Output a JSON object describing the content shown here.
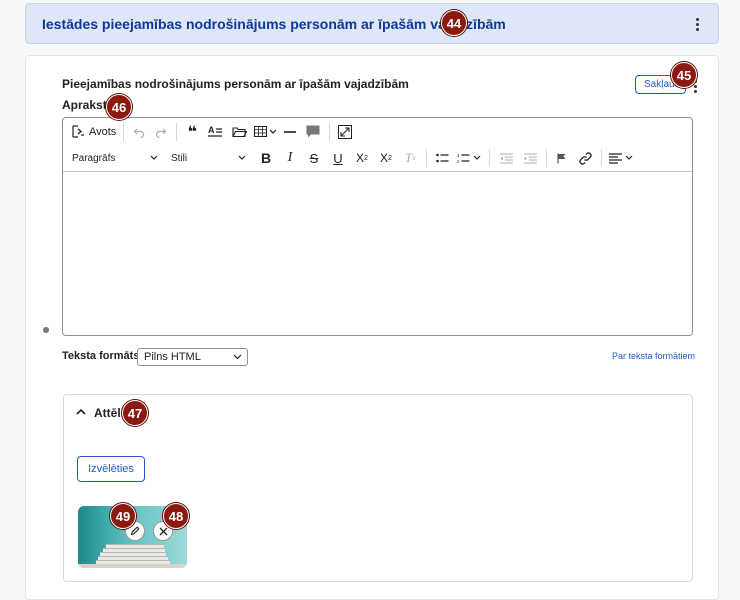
{
  "header": {
    "title": "Iestādes pieejamības nodrošinājums personām ar īpašām vajadzībām"
  },
  "field": {
    "title": "Pieejamības nodrošinājums personām ar īpašām vajadzībām",
    "collapse_label": "Sakļaut"
  },
  "description": {
    "label": "Apraksts",
    "toolbar": {
      "source_label": "Avots",
      "paragraph_label": "Paragrāfs",
      "styles_label": "Stili",
      "bold_label": "B",
      "italic_label": "I",
      "strike_label": "S",
      "underline_label": "U",
      "superscript_label": "X",
      "subscript_label": "X",
      "clear_format_label": "T"
    }
  },
  "text_format": {
    "label": "Teksta formāts",
    "selected": "Pilns HTML",
    "help_link": "Par teksta formātiem"
  },
  "images": {
    "title": "Attēli",
    "choose_label": "Izvēlēties"
  },
  "badges": {
    "b44": "44",
    "b45": "45",
    "b46": "46",
    "b47": "47",
    "b48": "48",
    "b49": "49"
  },
  "icons": [
    "source-icon",
    "undo-icon",
    "redo-icon",
    "blockquote-icon",
    "text-style-icon",
    "folder-icon",
    "table-icon",
    "horizontal-line-icon",
    "comment-icon",
    "fullscreen-icon",
    "bulleted-list-icon",
    "numbered-list-icon",
    "outdent-icon",
    "indent-icon",
    "flag-icon",
    "link-icon",
    "align-icon",
    "chevron-down-icon",
    "chevron-up-icon",
    "pencil-icon",
    "close-icon",
    "kebab-icon"
  ],
  "colors": {
    "accent": "#2458c4",
    "header_bg": "#dfe6f7",
    "badge": "#8b1a10"
  }
}
